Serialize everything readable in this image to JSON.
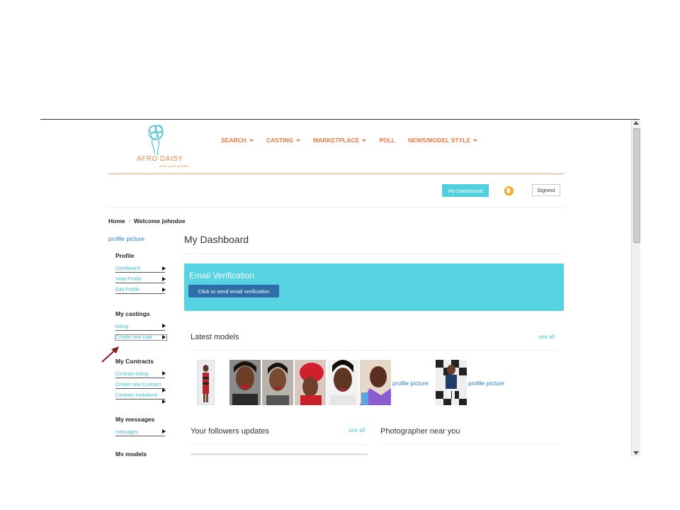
{
  "brand": {
    "logo_text": "AFRO DAISY",
    "logo_sub": "AFRO DAISY MODELS"
  },
  "nav": [
    {
      "label": "SEARCH",
      "dropdown": true
    },
    {
      "label": "CASTING",
      "dropdown": true
    },
    {
      "label": "MARKETPLACE",
      "dropdown": true
    },
    {
      "label": "POLL",
      "dropdown": false
    },
    {
      "label": "NEWS/MODEL STYLE",
      "dropdown": true
    }
  ],
  "header": {
    "dashboard_label": "My Dashboard",
    "signout_label": "Signout"
  },
  "breadcrumb": {
    "home": "Home",
    "sep": "/",
    "current": "Welcome johndoe"
  },
  "sidebar": {
    "profile_picture": "profile picture",
    "profile_title": "Profile",
    "profile_links": [
      "Dashboard",
      "View Profile",
      "Edit Profile"
    ],
    "castings_title": "My castings",
    "castings_links": [
      "listing",
      "Create new cast"
    ],
    "contracts_title": "My Contracts",
    "contracts_links": [
      "Contract listing",
      "Create new Contract",
      "Contract invitations"
    ],
    "messages_title": "My messages",
    "messages_links": [
      "messages"
    ],
    "models_title": "My models"
  },
  "main": {
    "title": "My Dashboard",
    "verify_title": "Email Verification",
    "verify_button": "Click to send email verification",
    "latest_models": "Latest models",
    "see_all": "see all",
    "profile_picture_label": "profile picture",
    "followers_title": "Your followers updates",
    "photographer_title": "Photographer near you"
  },
  "colors": {
    "accent_orange": "#f0763a",
    "teal": "#56d3e2",
    "verify_button": "#2e6ea8",
    "link_blue": "#2a7fc4"
  }
}
